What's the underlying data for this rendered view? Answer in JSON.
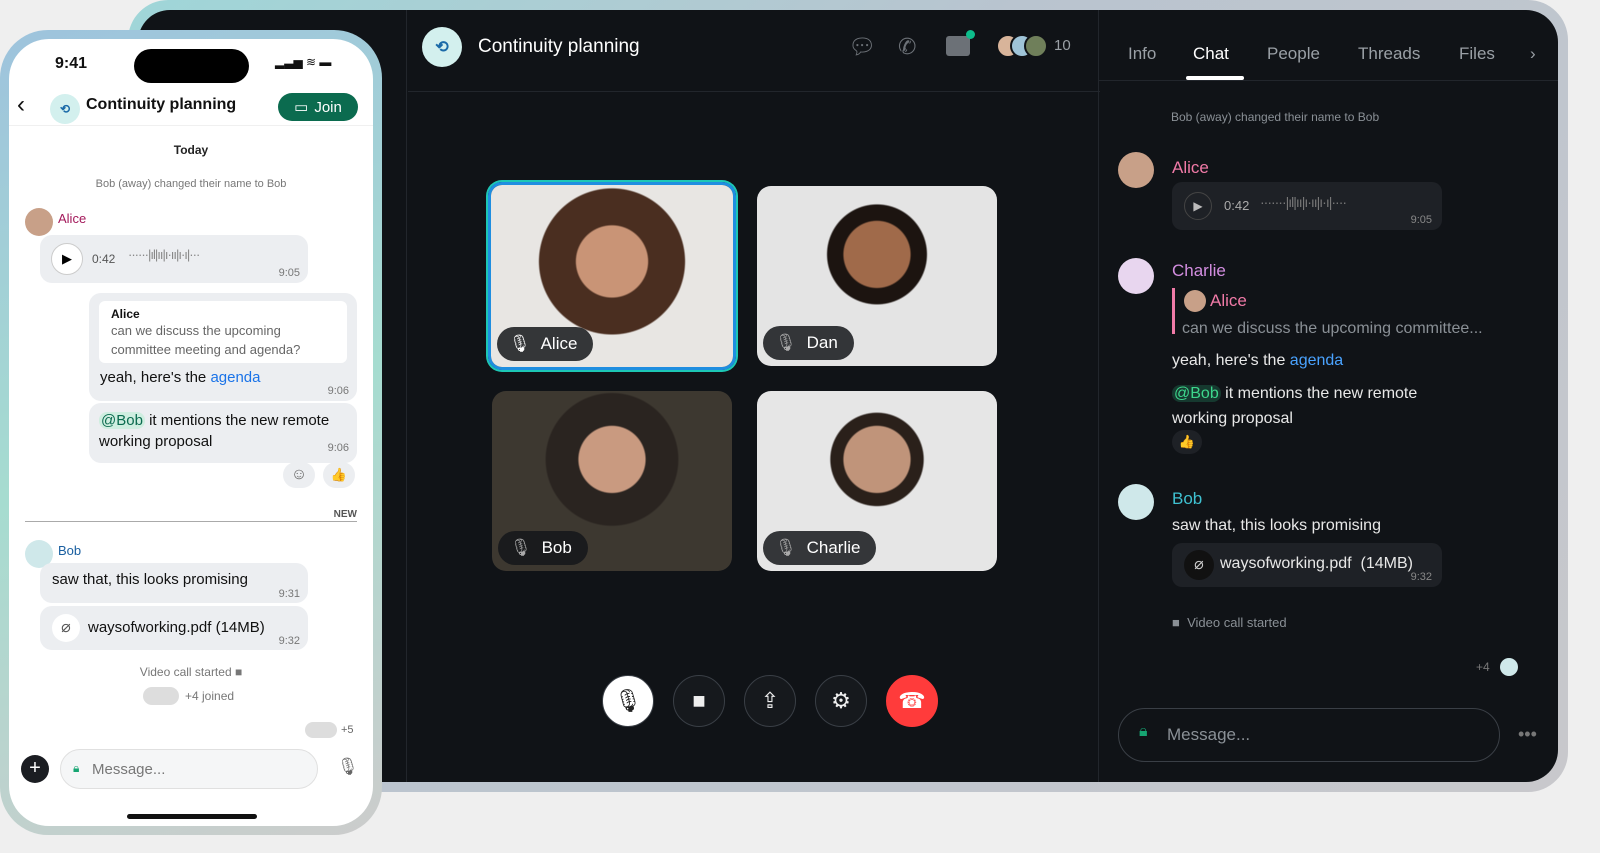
{
  "room": {
    "title": "Continuity planning",
    "member_count": "10"
  },
  "tabs": [
    {
      "label": "Info"
    },
    {
      "label": "Chat",
      "active": true
    },
    {
      "label": "People"
    },
    {
      "label": "Threads"
    },
    {
      "label": "Files"
    }
  ],
  "participants": [
    {
      "name": "Alice",
      "muted": false,
      "speaking": true
    },
    {
      "name": "Dan",
      "muted": true
    },
    {
      "name": "Bob",
      "muted": true
    },
    {
      "name": "Charlie",
      "muted": true
    }
  ],
  "colors": {
    "accent_green": "#0b6b4f",
    "alice": "#f07aa7",
    "charlie": "#d38ee0",
    "bob": "#3fc1d1",
    "hangup": "#ff3b3b",
    "link": "#1a73e8"
  },
  "chat": {
    "system_name_change": "Bob (away) changed their name to Bob",
    "alice_name": "Alice",
    "voice_duration": "0:42",
    "voice_time": "9:05",
    "charlie_name": "Charlie",
    "reply_to": "Alice",
    "reply_quote_short": "can we discuss the upcoming committee...",
    "reply_text": "yeah, here's the ",
    "reply_link": "agenda",
    "mention": "@Bob",
    "mention_text": " it mentions the new remote working proposal",
    "reaction": "👍",
    "bob_name": "Bob",
    "bob_text": "saw that, this looks promising",
    "file": "waysofworking.pdf",
    "file_size": "(14MB)",
    "file_time": "9:32",
    "video_call": "Video call started",
    "read_extra": "+4",
    "composer_placeholder": "Message..."
  },
  "phone": {
    "time": "9:41",
    "join_label": "Join",
    "day": "Today",
    "reply_quote": "can we discuss the upcoming committee meeting and agenda?",
    "reply_time": "9:06",
    "mention_time": "9:06",
    "new_label": "NEW",
    "bob_time": "9:31",
    "joined": "+4 joined",
    "read_extra": "+5"
  }
}
